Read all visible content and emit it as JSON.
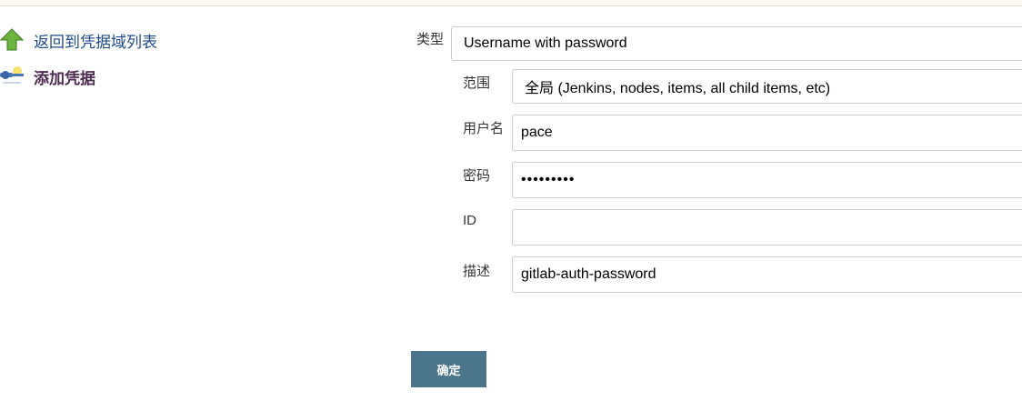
{
  "sidebar": {
    "back_link": {
      "label": "返回到凭据域列表",
      "icon": "arrow-up-icon"
    },
    "add_link": {
      "label": "添加凭据",
      "icon": "key-icon"
    }
  },
  "form": {
    "kind": {
      "label": "类型",
      "value": "Username with password"
    },
    "scope": {
      "label": "范围",
      "value": "全局 (Jenkins, nodes, items, all child items, etc)"
    },
    "username": {
      "label": "用户名",
      "value": "pace"
    },
    "password": {
      "label": "密码",
      "value": "•••••••••"
    },
    "id": {
      "label": "ID",
      "value": ""
    },
    "description": {
      "label": "描述",
      "value": "gitlab-auth-password"
    },
    "submit_label": "确定"
  },
  "colors": {
    "link": "#204a87",
    "active_link": "#4e2b51",
    "button": "#4b758b",
    "arrow": "#5a9e2e"
  }
}
